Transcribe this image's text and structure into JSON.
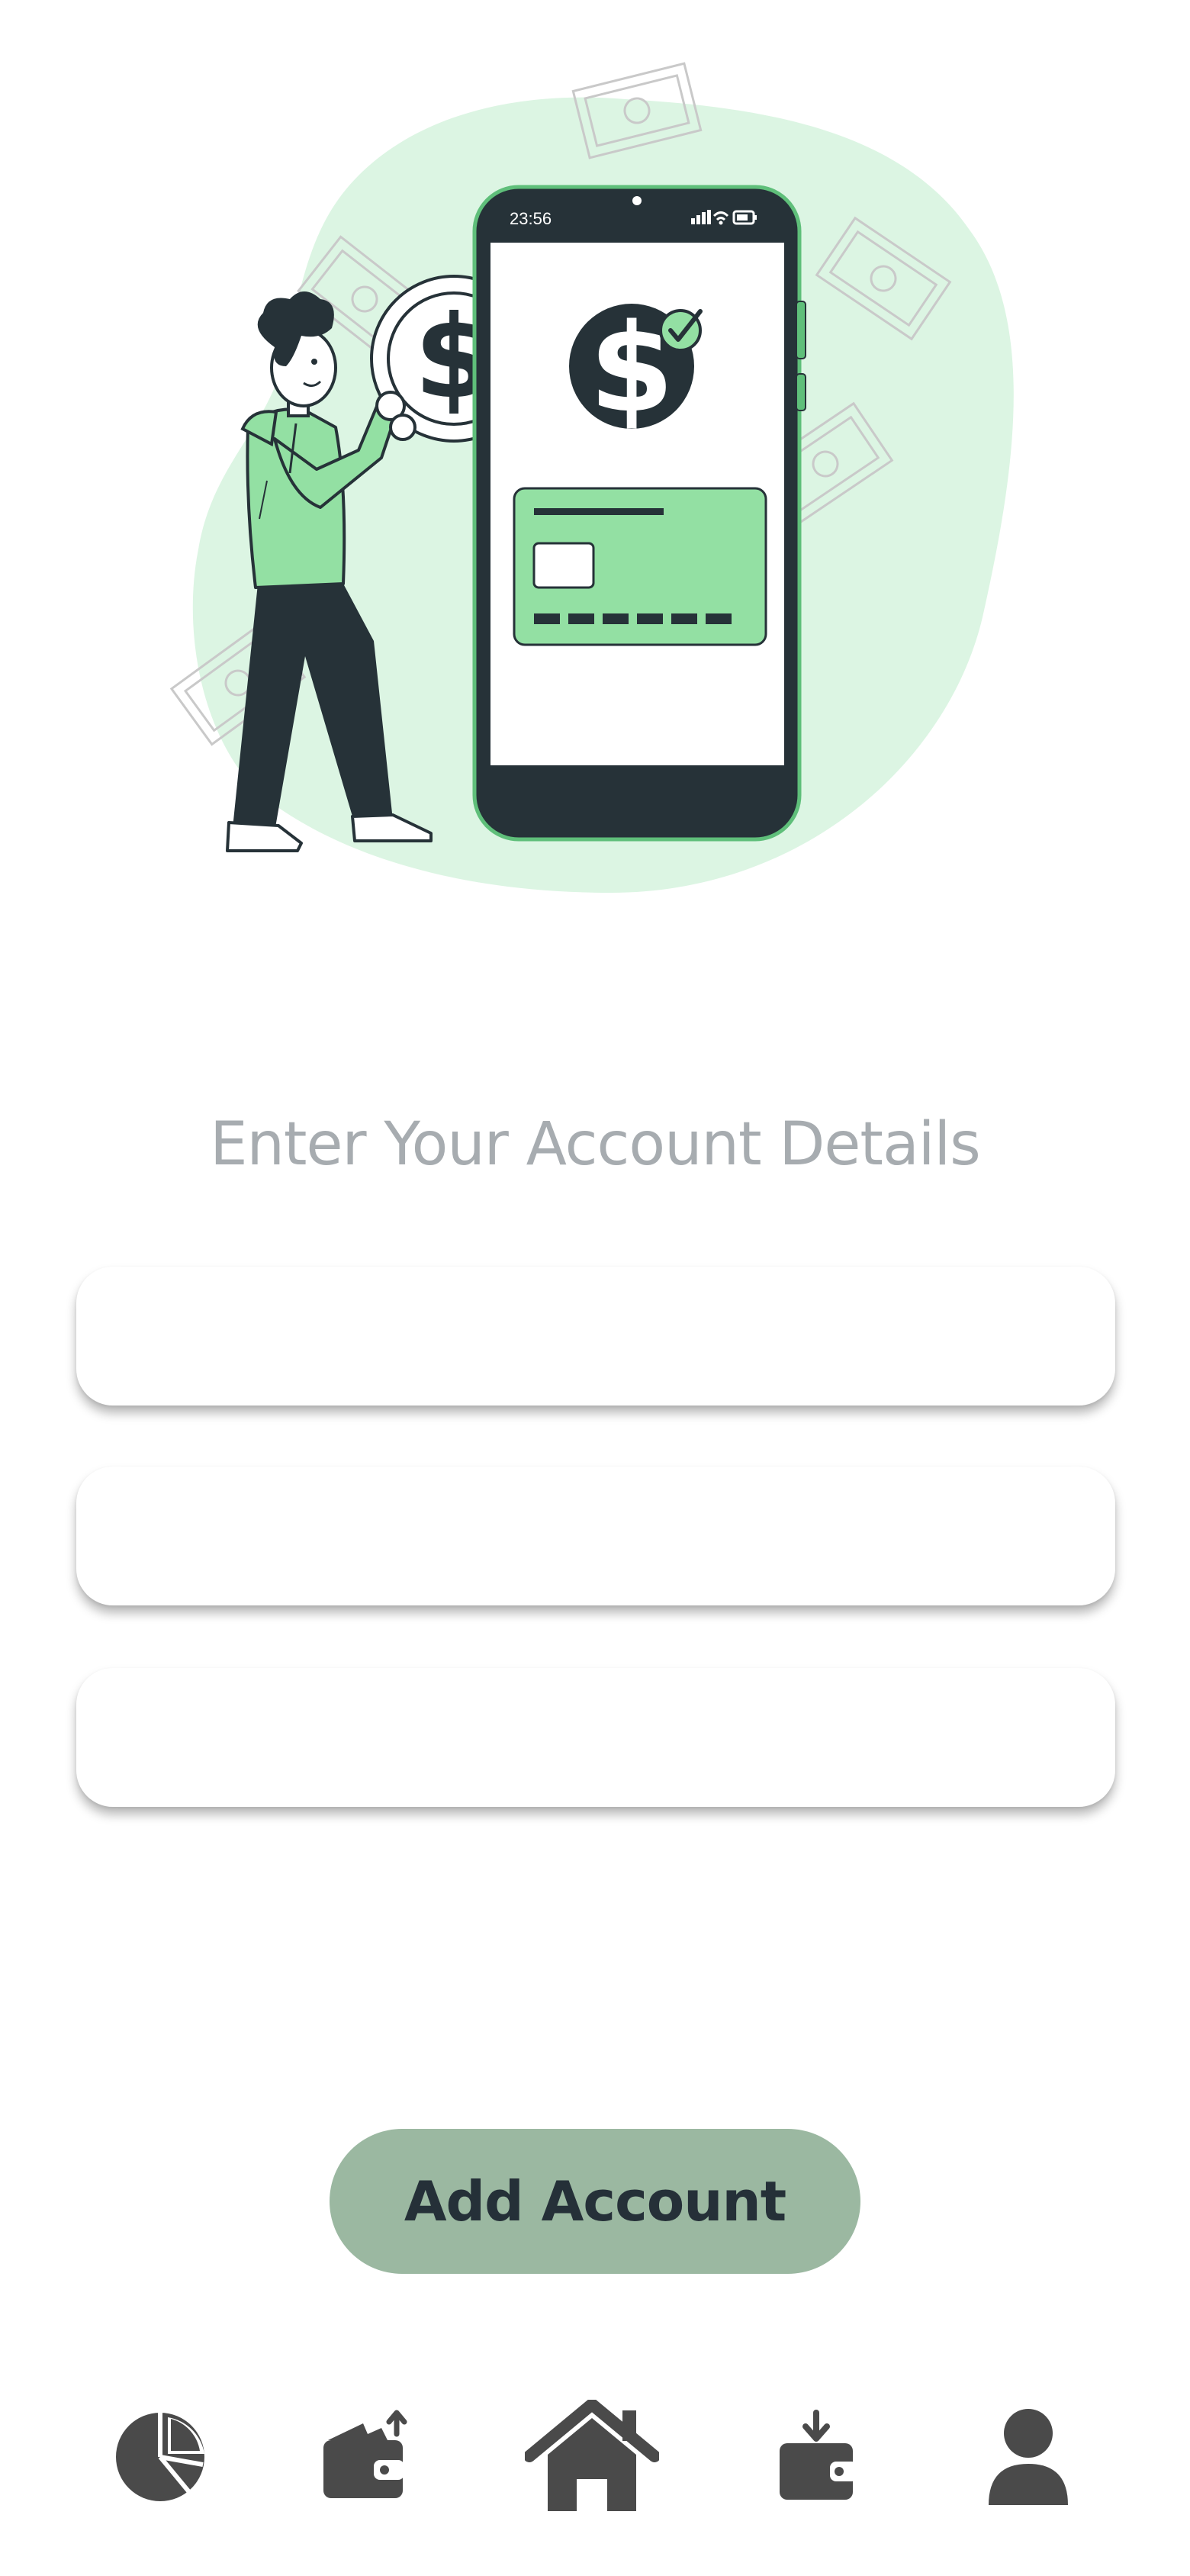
{
  "illustration": {
    "phone_time": "23:56",
    "currency_symbol": "$",
    "colors": {
      "blob": "#dcf5e3",
      "phone_frame": "#27343a",
      "phone_border": "#5fbf7a",
      "card": "#93e0a3",
      "outline": "#263238",
      "hoodie": "#93e0a3"
    }
  },
  "form": {
    "title": "Enter Your Account Details",
    "fields": [
      {
        "value": "",
        "placeholder": ""
      },
      {
        "value": "",
        "placeholder": ""
      },
      {
        "value": "",
        "placeholder": ""
      }
    ]
  },
  "actions": {
    "add_account_label": "Add Account",
    "button_color": "#9bb8a1"
  },
  "bottom_nav": {
    "icon_color": "#4a4a4a",
    "items": [
      {
        "icon": "pie-chart-icon"
      },
      {
        "icon": "wallet-send-icon"
      },
      {
        "icon": "home-icon",
        "active": true
      },
      {
        "icon": "wallet-receive-icon"
      },
      {
        "icon": "user-icon"
      }
    ]
  }
}
